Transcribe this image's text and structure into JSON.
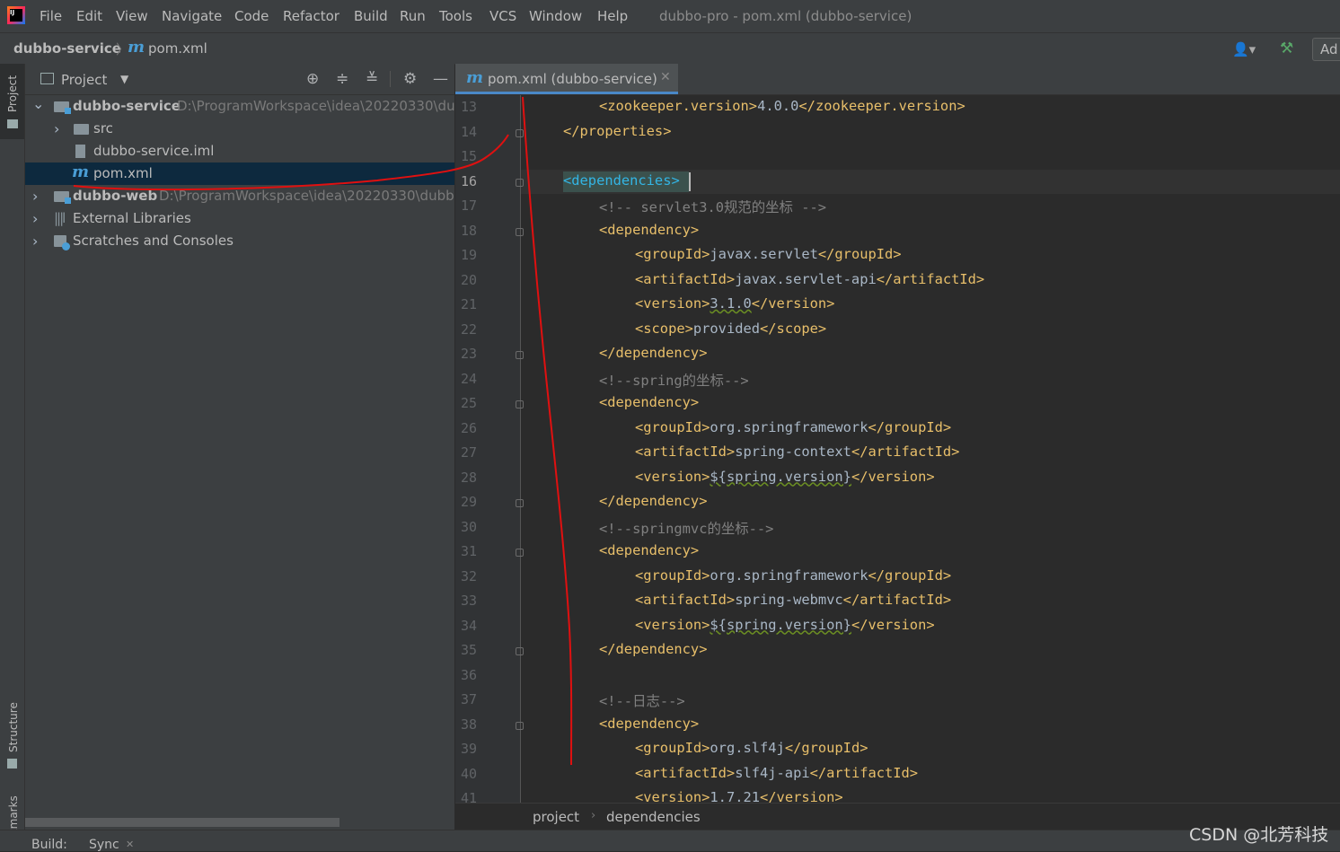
{
  "menu": {
    "logo_text": "IJ",
    "items": [
      "File",
      "Edit",
      "View",
      "Navigate",
      "Code",
      "Refactor",
      "Build",
      "Run",
      "Tools",
      "VCS",
      "Window",
      "Help"
    ],
    "window_title": "dubbo-pro - pom.xml (dubbo-service)"
  },
  "navbar": {
    "project": "dubbo-service",
    "file_icon": "m",
    "file": "pom.xml",
    "add_config_label": "Ad"
  },
  "left_strip": {
    "project_label": "Project",
    "structure_label": "Structure",
    "bookmarks_label": "ookmarks"
  },
  "project_panel": {
    "title": "Project",
    "tree": [
      {
        "label": "dubbo-service",
        "path": "D:\\ProgramWorkspace\\idea\\20220330\\dul",
        "bold": true,
        "expanded": true
      },
      {
        "label": "src"
      },
      {
        "label": "dubbo-service.iml"
      },
      {
        "label": "pom.xml",
        "icon": "m",
        "selected": true
      },
      {
        "label": "dubbo-web",
        "path": "D:\\ProgramWorkspace\\idea\\20220330\\dubbc",
        "bold": true
      },
      {
        "label": "External Libraries"
      },
      {
        "label": "Scratches and Consoles"
      }
    ]
  },
  "bottom_bar": {
    "build_label": "Build:",
    "sync_label": "Sync"
  },
  "editor": {
    "tab": {
      "icon": "m",
      "label": "pom.xml (dubbo-service)"
    },
    "current_line": 16,
    "lines": [
      {
        "n": 13,
        "indent": 2,
        "parts": [
          [
            "tag",
            "<zookeeper.version>"
          ],
          [
            "txt",
            "4.0.0"
          ],
          [
            "tag",
            "</zookeeper.version>"
          ]
        ]
      },
      {
        "n": 14,
        "indent": 1,
        "parts": [
          [
            "tag",
            "</properties>"
          ]
        ]
      },
      {
        "n": 15,
        "indent": 0,
        "parts": []
      },
      {
        "n": 16,
        "indent": 1,
        "parts": [
          [
            "tagc",
            "<dependencies>"
          ]
        ]
      },
      {
        "n": 17,
        "indent": 2,
        "parts": [
          [
            "cmt",
            "<!-- servlet3.0规范的坐标 -->"
          ]
        ]
      },
      {
        "n": 18,
        "indent": 2,
        "parts": [
          [
            "tag",
            "<dependency>"
          ]
        ]
      },
      {
        "n": 19,
        "indent": 3,
        "parts": [
          [
            "tag",
            "<groupId>"
          ],
          [
            "txt",
            "javax.servlet"
          ],
          [
            "tag",
            "</groupId>"
          ]
        ]
      },
      {
        "n": 20,
        "indent": 3,
        "parts": [
          [
            "tag",
            "<artifactId>"
          ],
          [
            "txt",
            "javax.servlet-api"
          ],
          [
            "tag",
            "</artifactId>"
          ]
        ]
      },
      {
        "n": 21,
        "indent": 3,
        "parts": [
          [
            "tag",
            "<version>"
          ],
          [
            "squig",
            "3.1.0"
          ],
          [
            "tag",
            "</version>"
          ]
        ]
      },
      {
        "n": 22,
        "indent": 3,
        "parts": [
          [
            "tag",
            "<scope>"
          ],
          [
            "txt",
            "provided"
          ],
          [
            "tag",
            "</scope>"
          ]
        ]
      },
      {
        "n": 23,
        "indent": 2,
        "parts": [
          [
            "tag",
            "</dependency>"
          ]
        ]
      },
      {
        "n": 24,
        "indent": 2,
        "parts": [
          [
            "cmt",
            "<!--spring的坐标-->"
          ]
        ]
      },
      {
        "n": 25,
        "indent": 2,
        "parts": [
          [
            "tag",
            "<dependency>"
          ]
        ]
      },
      {
        "n": 26,
        "indent": 3,
        "parts": [
          [
            "tag",
            "<groupId>"
          ],
          [
            "txt",
            "org.springframework"
          ],
          [
            "tag",
            "</groupId>"
          ]
        ]
      },
      {
        "n": 27,
        "indent": 3,
        "parts": [
          [
            "tag",
            "<artifactId>"
          ],
          [
            "txt",
            "spring-context"
          ],
          [
            "tag",
            "</artifactId>"
          ]
        ]
      },
      {
        "n": 28,
        "indent": 3,
        "parts": [
          [
            "tag",
            "<version>"
          ],
          [
            "squig",
            "${spring.version}"
          ],
          [
            "tag",
            "</version>"
          ]
        ]
      },
      {
        "n": 29,
        "indent": 2,
        "parts": [
          [
            "tag",
            "</dependency>"
          ]
        ]
      },
      {
        "n": 30,
        "indent": 2,
        "parts": [
          [
            "cmt",
            "<!--springmvc的坐标-->"
          ]
        ]
      },
      {
        "n": 31,
        "indent": 2,
        "parts": [
          [
            "tag",
            "<dependency>"
          ]
        ]
      },
      {
        "n": 32,
        "indent": 3,
        "parts": [
          [
            "tag",
            "<groupId>"
          ],
          [
            "txt",
            "org.springframework"
          ],
          [
            "tag",
            "</groupId>"
          ]
        ]
      },
      {
        "n": 33,
        "indent": 3,
        "parts": [
          [
            "tag",
            "<artifactId>"
          ],
          [
            "txt",
            "spring-webmvc"
          ],
          [
            "tag",
            "</artifactId>"
          ]
        ]
      },
      {
        "n": 34,
        "indent": 3,
        "parts": [
          [
            "tag",
            "<version>"
          ],
          [
            "squig",
            "${spring.version}"
          ],
          [
            "tag",
            "</version>"
          ]
        ]
      },
      {
        "n": 35,
        "indent": 2,
        "parts": [
          [
            "tag",
            "</dependency>"
          ]
        ]
      },
      {
        "n": 36,
        "indent": 0,
        "parts": []
      },
      {
        "n": 37,
        "indent": 2,
        "parts": [
          [
            "cmt",
            "<!--日志-->"
          ]
        ]
      },
      {
        "n": 38,
        "indent": 2,
        "parts": [
          [
            "tag",
            "<dependency>"
          ]
        ]
      },
      {
        "n": 39,
        "indent": 3,
        "parts": [
          [
            "tag",
            "<groupId>"
          ],
          [
            "txt",
            "org.slf4j"
          ],
          [
            "tag",
            "</groupId>"
          ]
        ]
      },
      {
        "n": 40,
        "indent": 3,
        "parts": [
          [
            "tag",
            "<artifactId>"
          ],
          [
            "txt",
            "slf4j-api"
          ],
          [
            "tag",
            "</artifactId>"
          ]
        ]
      },
      {
        "n": 41,
        "indent": 3,
        "parts": [
          [
            "tag",
            "<version>"
          ],
          [
            "txt",
            "1.7.21"
          ],
          [
            "tag",
            "</version>"
          ]
        ]
      }
    ],
    "fold_markers": [
      14,
      16,
      18,
      23,
      25,
      29,
      31,
      35,
      38
    ],
    "breadcrumb": [
      "project",
      "dependencies"
    ]
  },
  "watermark": "CSDN @北芳科技",
  "colors": {
    "tag": "#e8bf6a",
    "text": "#a9b7c6",
    "comment": "#808080",
    "annotation": "#e01010"
  }
}
